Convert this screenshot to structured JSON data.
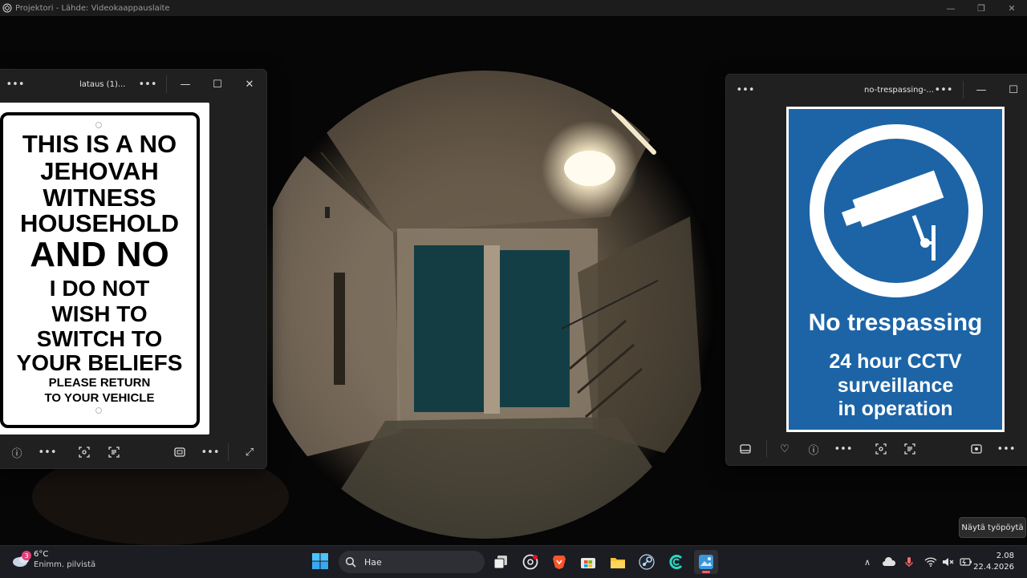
{
  "projector": {
    "title": "Projektori - Lähde: Videokaappauslaite"
  },
  "viewer_left": {
    "title": "lataus (1)...",
    "sign_lines": [
      "THIS IS A NO",
      "JEHOVAH",
      "WITNESS",
      "HOUSEHOLD",
      "AND NO",
      "I DO NOT",
      "WISH TO",
      "SWITCH TO",
      "YOUR BELIEFS",
      "PLEASE RETURN",
      "TO YOUR VEHICLE"
    ]
  },
  "viewer_right": {
    "title": "no-trespassing-...",
    "sign_heading": "No trespassing",
    "sign_lines": [
      "24 hour CCTV",
      "surveillance",
      "in operation"
    ],
    "sign_color": "#1c64a6"
  },
  "tooltip": "Näytä työpöytä",
  "taskbar": {
    "weather": {
      "temp": "6°C",
      "desc": "Enimm. pilvistä",
      "badge": "3"
    },
    "search_placeholder": "Hae",
    "clock": {
      "time": "2.08",
      "date": "22.4.2026"
    }
  }
}
